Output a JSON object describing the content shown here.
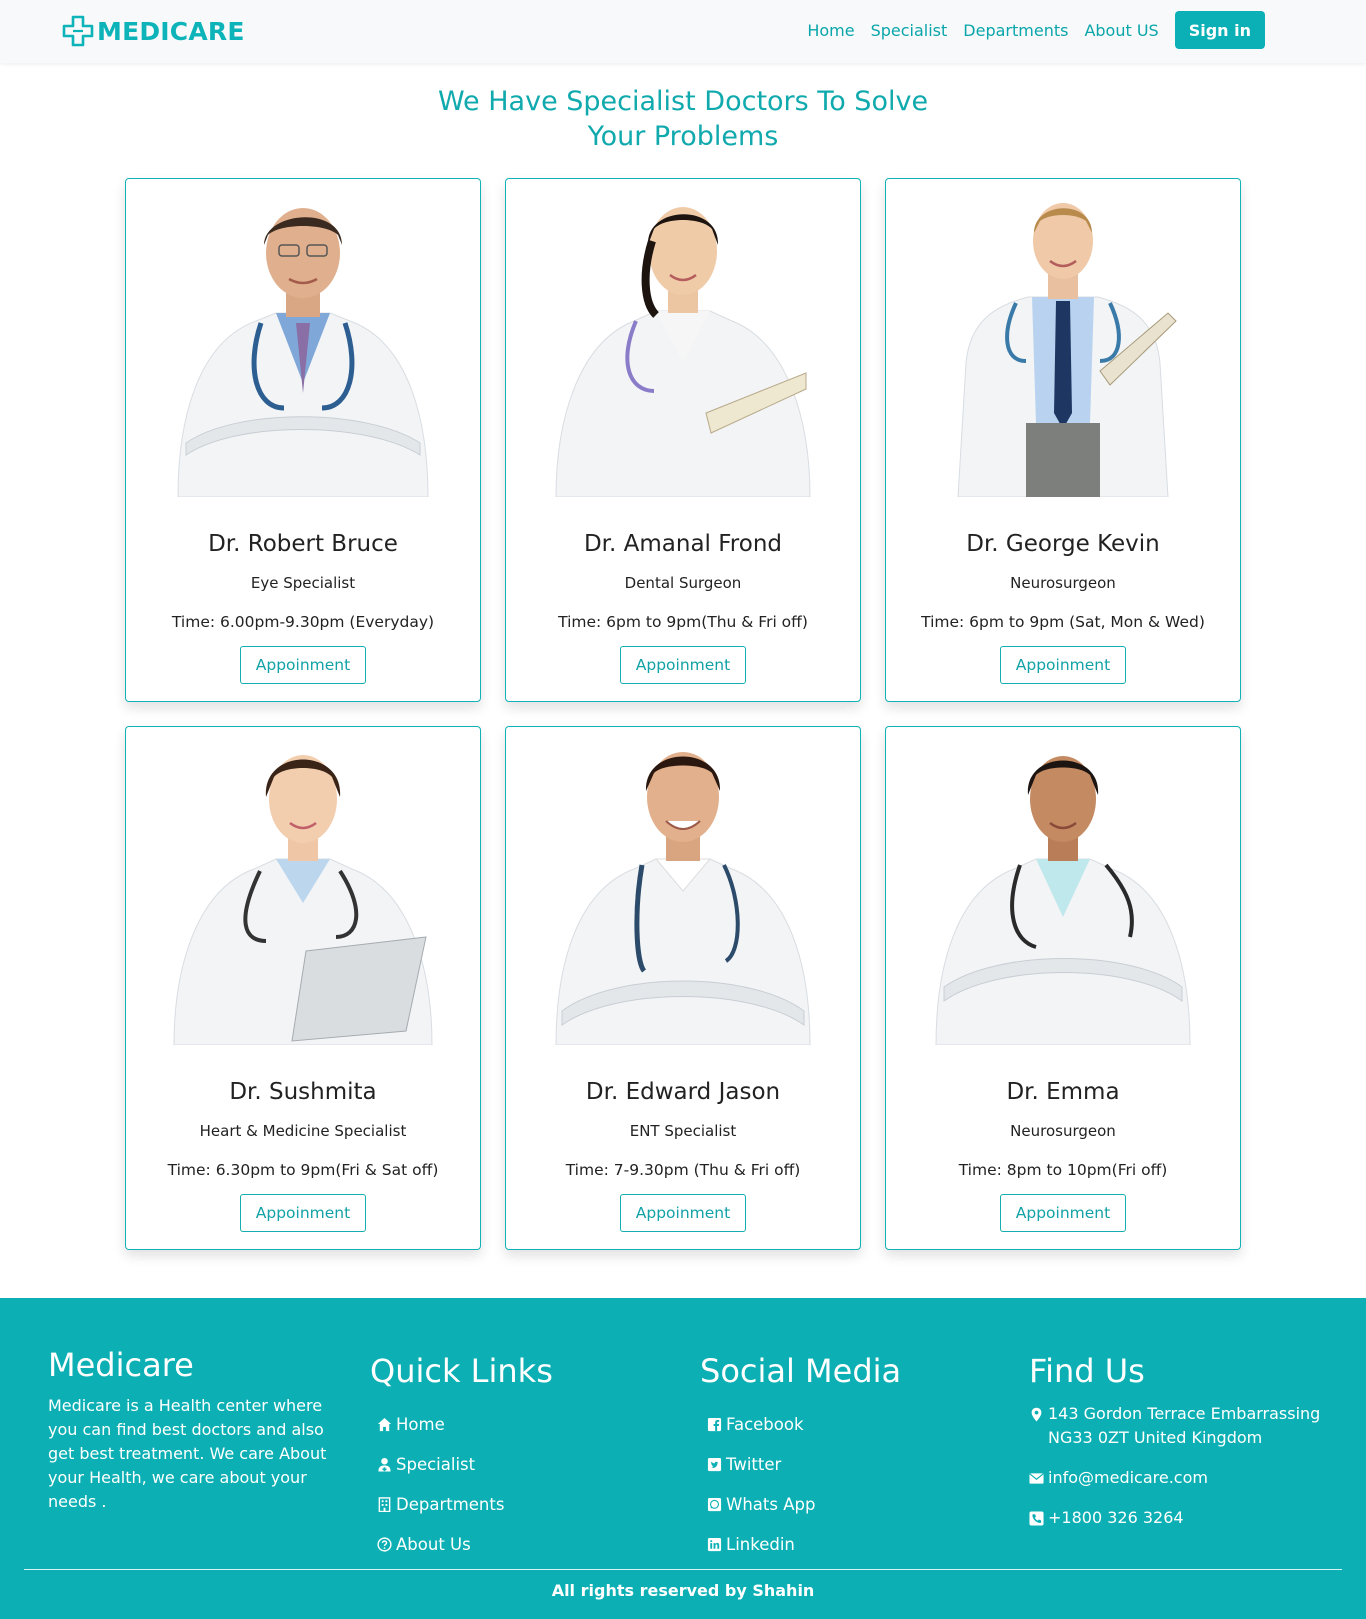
{
  "navbar": {
    "brand": "MEDICARE",
    "links": [
      "Home",
      "Specialist",
      "Departments",
      "About US"
    ],
    "signin_label": "Sign in"
  },
  "hero": {
    "title_line1": "We Have Specialist Doctors To Solve",
    "title_line2": "Your Problems"
  },
  "doctors": [
    {
      "name": "Dr. Robert Bruce",
      "specialty": "Eye Specialist",
      "time": "Time: 6.00pm-9.30pm (Everyday)",
      "button": "Appoinment"
    },
    {
      "name": "Dr. Amanal Frond",
      "specialty": "Dental Surgeon",
      "time": "Time: 6pm to 9pm(Thu & Fri off)",
      "button": "Appoinment"
    },
    {
      "name": "Dr. George Kevin",
      "specialty": "Neurosurgeon",
      "time": "Time: 6pm to 9pm (Sat, Mon & Wed)",
      "button": "Appoinment"
    },
    {
      "name": "Dr. Sushmita",
      "specialty": "Heart & Medicine Specialist",
      "time": "Time: 6.30pm to 9pm(Fri & Sat off)",
      "button": "Appoinment"
    },
    {
      "name": "Dr. Edward Jason",
      "specialty": "ENT Specialist",
      "time": "Time: 7-9.30pm (Thu & Fri off)",
      "button": "Appoinment"
    },
    {
      "name": "Dr. Emma",
      "specialty": "Neurosurgeon",
      "time": "Time: 8pm to 10pm(Fri off)",
      "button": "Appoinment"
    }
  ],
  "footer": {
    "about_title": "Medicare",
    "about_text": "Medicare is a Health center where you can find best doctors and also get best treatment. We care About your Health, we care about your needs .",
    "quick_links_title": "Quick Links",
    "quick_links": [
      {
        "label": "Home",
        "icon": "home-icon"
      },
      {
        "label": "Specialist",
        "icon": "doctor-icon"
      },
      {
        "label": "Departments",
        "icon": "building-icon"
      },
      {
        "label": "About Us",
        "icon": "question-circle-icon"
      }
    ],
    "social_title": "Social Media",
    "social_links": [
      {
        "label": "Facebook",
        "icon": "facebook-icon"
      },
      {
        "label": "Twitter",
        "icon": "twitter-icon"
      },
      {
        "label": "Whats App",
        "icon": "whatsapp-icon"
      },
      {
        "label": "Linkedin",
        "icon": "linkedin-icon"
      }
    ],
    "find_title": "Find Us",
    "address": "143 Gordon Terrace Embarrassing NG33 0ZT United Kingdom",
    "email": "info@medicare.com",
    "phone": "+1800 326 3264",
    "copyright": "All rights reserved by Shahin"
  },
  "colors": {
    "accent": "#0cb0b4",
    "text": "#222222",
    "navbar_bg": "#f8f9fa"
  }
}
